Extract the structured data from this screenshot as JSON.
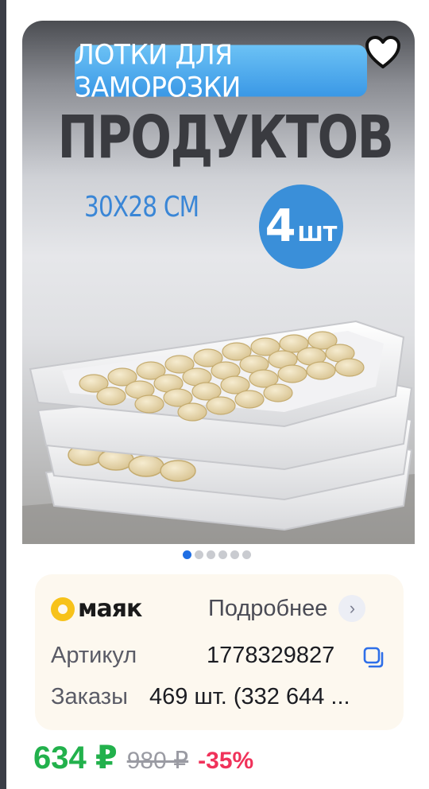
{
  "product": {
    "banner_label": "ЛОТКИ ДЛЯ ЗАМОРОЗКИ",
    "headline": "ПРОДУКТОВ",
    "size": "30Х28 СМ",
    "qty_number": "4",
    "qty_unit": "ШТ"
  },
  "carousel": {
    "total": 6,
    "active_index": 0
  },
  "info": {
    "brand": "маяк",
    "more_label": "Подробнее",
    "article_label": "Артикул",
    "article_value": "1778329827",
    "orders_label": "Заказы",
    "orders_value": "469 шт. (332 644 ..."
  },
  "price": {
    "current": "634 ₽",
    "old": "980 ₽",
    "discount": "-35%"
  },
  "colors": {
    "accent_blue": "#3a8fd9",
    "price_green": "#22b14c",
    "discount_red": "#f0325a",
    "mayak_yellow": "#f7c21a"
  },
  "icons": {
    "favorite": "heart-icon",
    "more": "chevron-right-icon",
    "copy": "copy-icon",
    "brand": "mayak-logo-icon"
  }
}
